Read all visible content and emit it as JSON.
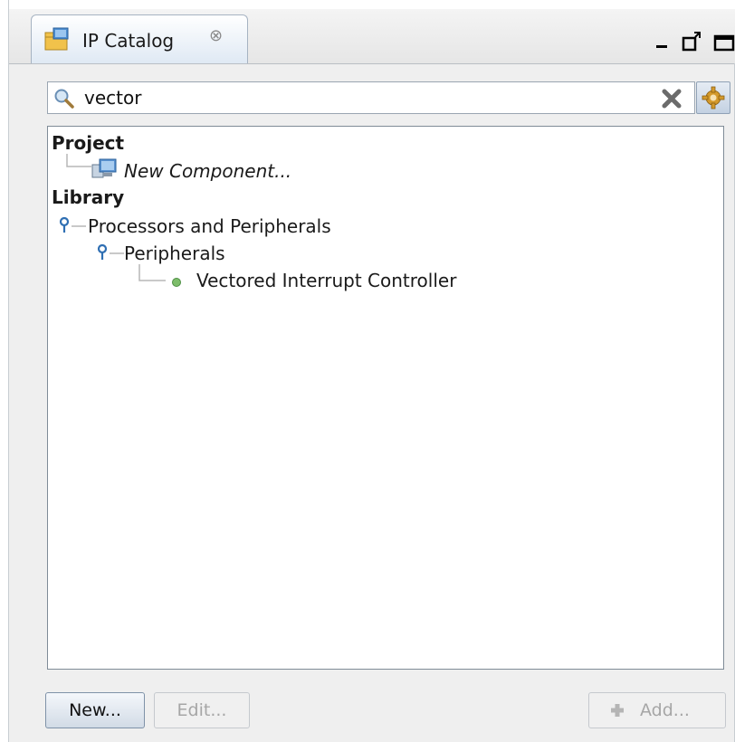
{
  "tab": {
    "title": "IP Catalog",
    "close_glyph": "⊗",
    "icon": "ip-catalog-icon"
  },
  "window_controls": {
    "minimize": "minimize-icon",
    "restore": "restore-icon",
    "maximize": "maximize-icon"
  },
  "search": {
    "value": "vector",
    "icon": "search-icon",
    "clear_icon": "clear-icon",
    "settings_icon": "gear-icon"
  },
  "tree": {
    "project": {
      "label": "Project",
      "children": [
        {
          "label": "New Component...",
          "icon": "component-icon"
        }
      ]
    },
    "library": {
      "label": "Library",
      "category": {
        "label": "Processors and Peripherals",
        "subcategory": {
          "label": "Peripherals",
          "items": [
            {
              "label": "Vectored Interrupt Controller",
              "icon": "bullet-icon"
            }
          ]
        }
      }
    }
  },
  "buttons": {
    "new": "New...",
    "edit": "Edit...",
    "add": "Add..."
  },
  "colors": {
    "panel_bg": "#efefef",
    "tab_gradient_bottom": "#dfe9f4",
    "tree_icon_blue": "#2f6fb3",
    "bullet_green": "#7dbd6a",
    "disabled_text": "#a6a6a6"
  }
}
